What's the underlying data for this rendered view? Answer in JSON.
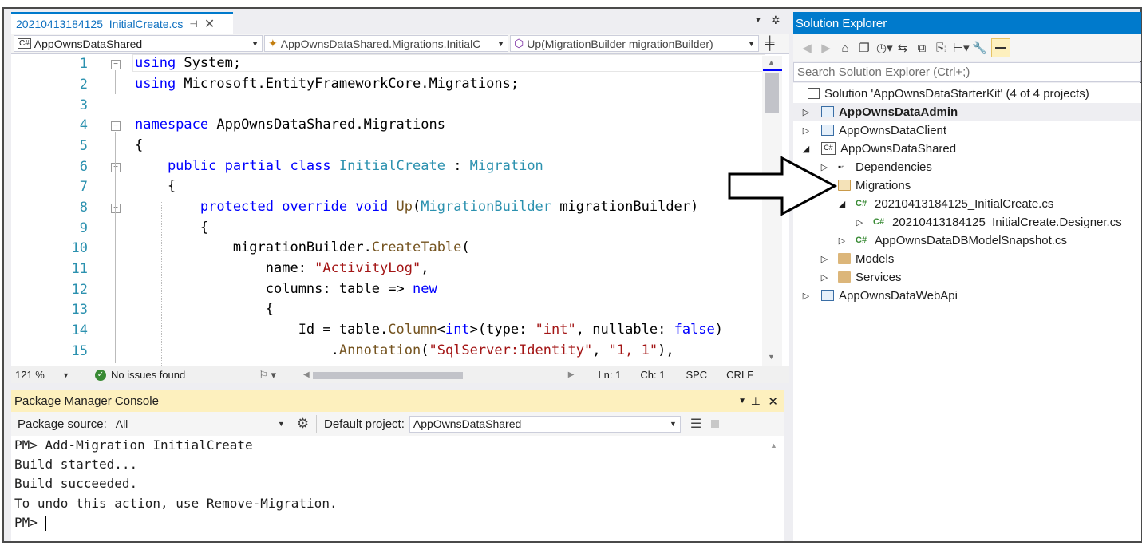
{
  "editor": {
    "tab_title": "20210413184125_InitialCreate.cs",
    "nav": {
      "project": "AppOwnsDataShared",
      "type": "AppOwnsDataShared.Migrations.InitialC",
      "member": "Up(MigrationBuilder migrationBuilder)"
    },
    "line_numbers": [
      "1",
      "2",
      "3",
      "4",
      "5",
      "6",
      "7",
      "8",
      "9",
      "10",
      "11",
      "12",
      "13",
      "14",
      "15"
    ],
    "code": {
      "l1_kw": "using",
      "l1_rest": " System;",
      "l2_kw": "using",
      "l2_rest": " Microsoft.EntityFrameworkCore.Migrations;",
      "l4_kw": "namespace",
      "l4_rest": " AppOwnsDataShared.Migrations",
      "l5": "{",
      "l6_kw": "    public partial class",
      "l6_type": "InitialCreate",
      "l6_colon": " : ",
      "l6_base": "Migration",
      "l7": "    {",
      "l8_kw": "        protected override void",
      "l8_method": "Up",
      "l8_open": "(",
      "l8_type": "MigrationBuilder",
      "l8_rest": " migrationBuilder)",
      "l9": "        {",
      "l10_a": "            migrationBuilder.",
      "l10_method": "CreateTable",
      "l10_b": "(",
      "l11_a": "                name: ",
      "l11_str": "\"ActivityLog\"",
      "l11_b": ",",
      "l12_a": "                columns: table => ",
      "l12_kw": "new",
      "l13": "                {",
      "l14_a": "                    Id = table.",
      "l14_method": "Column",
      "l14_lt": "<",
      "l14_kw": "int",
      "l14_b": ">(type: ",
      "l14_str": "\"int\"",
      "l14_c": ", nullable: ",
      "l14_kw2": "false",
      "l14_d": ")",
      "l15_a": "                        .",
      "l15_method": "Annotation",
      "l15_b": "(",
      "l15_str1": "\"SqlServer:Identity\"",
      "l15_c": ", ",
      "l15_str2": "\"1, 1\"",
      "l15_d": "),"
    },
    "status": {
      "zoom": "121 %",
      "issues": "No issues found",
      "line": "Ln: 1",
      "col": "Ch: 1",
      "spc": "SPC",
      "eol": "CRLF"
    }
  },
  "pm": {
    "title": "Package Manager Console",
    "source_label": "Package source:",
    "source_value": "All",
    "project_label": "Default project:",
    "project_value": "AppOwnsDataShared",
    "lines": [
      "PM> Add-Migration InitialCreate",
      "Build started...",
      "Build succeeded.",
      "To undo this action, use Remove-Migration.",
      "PM> "
    ]
  },
  "solution_explorer": {
    "title": "Solution Explorer",
    "search_placeholder": "Search Solution Explorer (Ctrl+;)",
    "items": [
      {
        "label": "Solution 'AppOwnsDataStarterKit' (4 of 4 projects)"
      },
      {
        "label": "AppOwnsDataAdmin"
      },
      {
        "label": "AppOwnsDataClient"
      },
      {
        "label": "AppOwnsDataShared"
      },
      {
        "label": "Dependencies"
      },
      {
        "label": "Migrations"
      },
      {
        "label": "20210413184125_InitialCreate.cs"
      },
      {
        "label": "20210413184125_InitialCreate.Designer.cs"
      },
      {
        "label": "AppOwnsDataDBModelSnapshot.cs"
      },
      {
        "label": "Models"
      },
      {
        "label": "Services"
      },
      {
        "label": "AppOwnsDataWebApi"
      }
    ],
    "cs_badge": "C#"
  },
  "colors": {
    "accent": "#007acc",
    "pm_title_bg": "#fdf0be",
    "keyword": "#0000ff",
    "type": "#2b91af",
    "string": "#a31515"
  }
}
